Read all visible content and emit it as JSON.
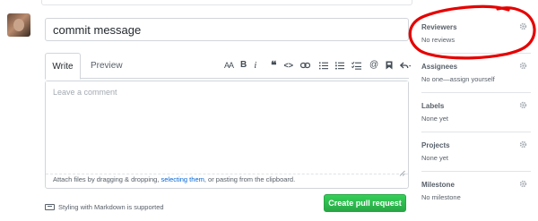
{
  "composer": {
    "title_value": "commit message",
    "tabs": [
      {
        "label": "Write"
      },
      {
        "label": "Preview"
      }
    ],
    "toolbar": {
      "header_label": "AA",
      "bold_label": "B",
      "italic_label": "i",
      "quote_label": "❝",
      "code_label": "<>",
      "mention_label": "@"
    },
    "body_placeholder": "Leave a comment",
    "attach": {
      "before": "Attach files by dragging & dropping, ",
      "link": "selecting them",
      "after": ", or pasting from the clipboard."
    },
    "markdown_hint": "Styling with Markdown is supported",
    "submit_label": "Create pull request"
  },
  "sidebar": {
    "sections": [
      {
        "heading": "Reviewers",
        "value": "No reviews"
      },
      {
        "heading": "Assignees",
        "value": "No one—assign yourself"
      },
      {
        "heading": "Labels",
        "value": "None yet"
      },
      {
        "heading": "Projects",
        "value": "None yet"
      },
      {
        "heading": "Milestone",
        "value": "No milestone"
      }
    ]
  },
  "colors": {
    "primary_button": "#28a745",
    "link": "#0366d6",
    "annotation": "#e60000"
  }
}
